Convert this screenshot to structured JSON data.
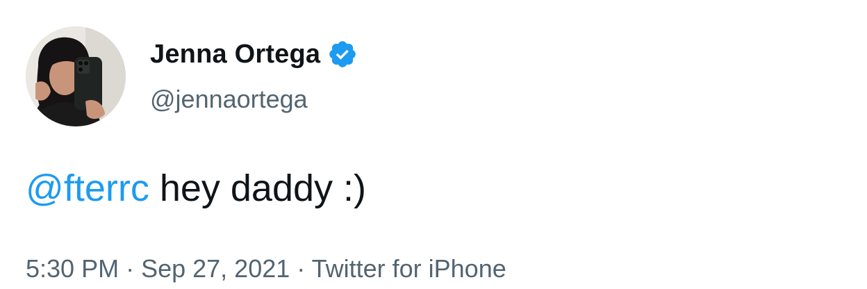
{
  "user": {
    "display_name": "Jenna Ortega",
    "handle": "@jennaortega",
    "verified": true,
    "avatar_icon": "profile-photo"
  },
  "tweet": {
    "mention": "@fterrc",
    "text": " hey daddy :)"
  },
  "meta": {
    "time": "5:30 PM",
    "separator": " · ",
    "date": "Sep 27, 2021",
    "source": "Twitter for iPhone"
  },
  "colors": {
    "accent": "#1d9bf0",
    "text": "#0f1419",
    "secondary": "#536471"
  }
}
